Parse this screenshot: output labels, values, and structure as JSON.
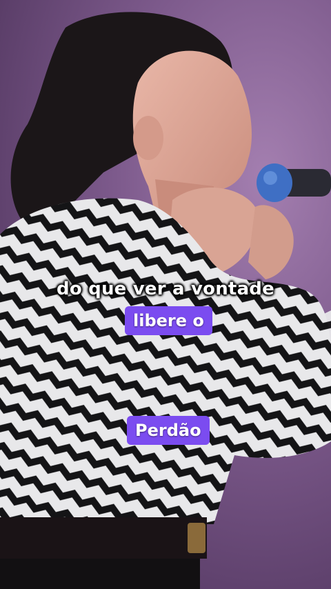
{
  "captions": {
    "line": "do que ver a vontade",
    "highlight_1": "libere o",
    "highlight_2": "Perdão"
  },
  "colors": {
    "highlight_bg": "#7b4cf0",
    "background": "#7d5a8c",
    "caption_text": "#ffffff"
  }
}
